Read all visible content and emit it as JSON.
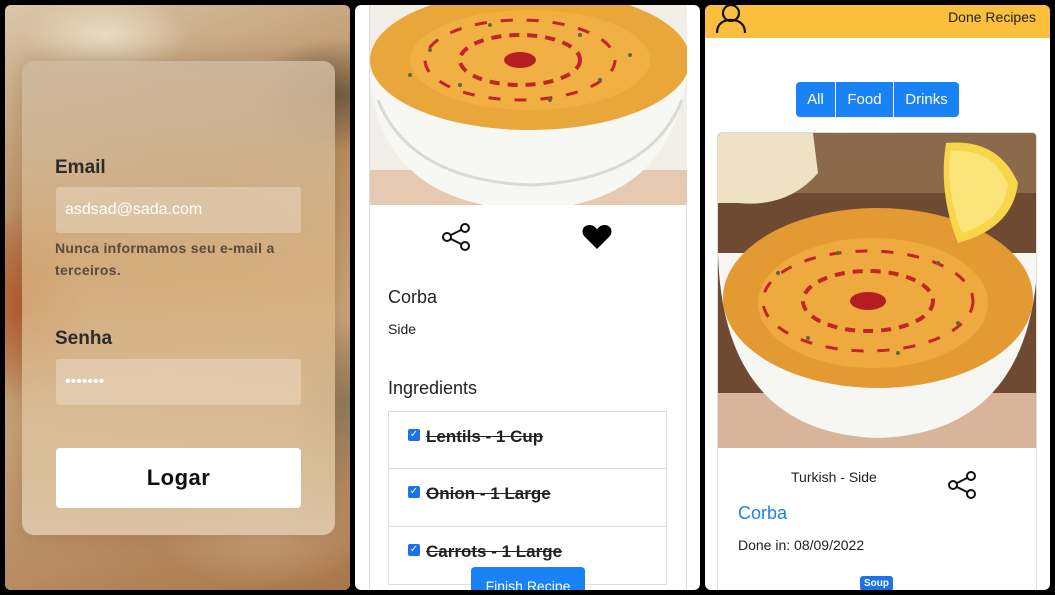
{
  "login": {
    "email_label": "Email",
    "email_value": "asdsad@sada.com",
    "email_help": "Nunca informamos seu e-mail a terceiros.",
    "password_label": "Senha",
    "password_value": "•••••••",
    "submit_label": "Logar"
  },
  "in_progress": {
    "recipe_title": "Corba",
    "recipe_category": "Side",
    "ingredients_heading": "Ingredients",
    "ingredients": [
      {
        "label": "Lentils - 1 Cup",
        "checked": true
      },
      {
        "label": "Onion - 1 Large",
        "checked": true
      },
      {
        "label": "Carrots - 1 Large",
        "checked": true
      }
    ],
    "favorite": true,
    "finish_label": "Finish Recipe"
  },
  "done_recipes": {
    "header_title": "Done Recipes",
    "filters": [
      "All",
      "Food",
      "Drinks"
    ],
    "card": {
      "origin_category": "Turkish - Side",
      "title": "Corba",
      "done_date": "Done in: 08/09/2022",
      "tag": "Soup"
    }
  },
  "colors": {
    "accent_blue": "#1a82f7",
    "header_yellow": "#fbbf3d"
  },
  "icons": {
    "share": "share-icon",
    "favorite": "heart-icon",
    "profile": "profile-icon"
  }
}
